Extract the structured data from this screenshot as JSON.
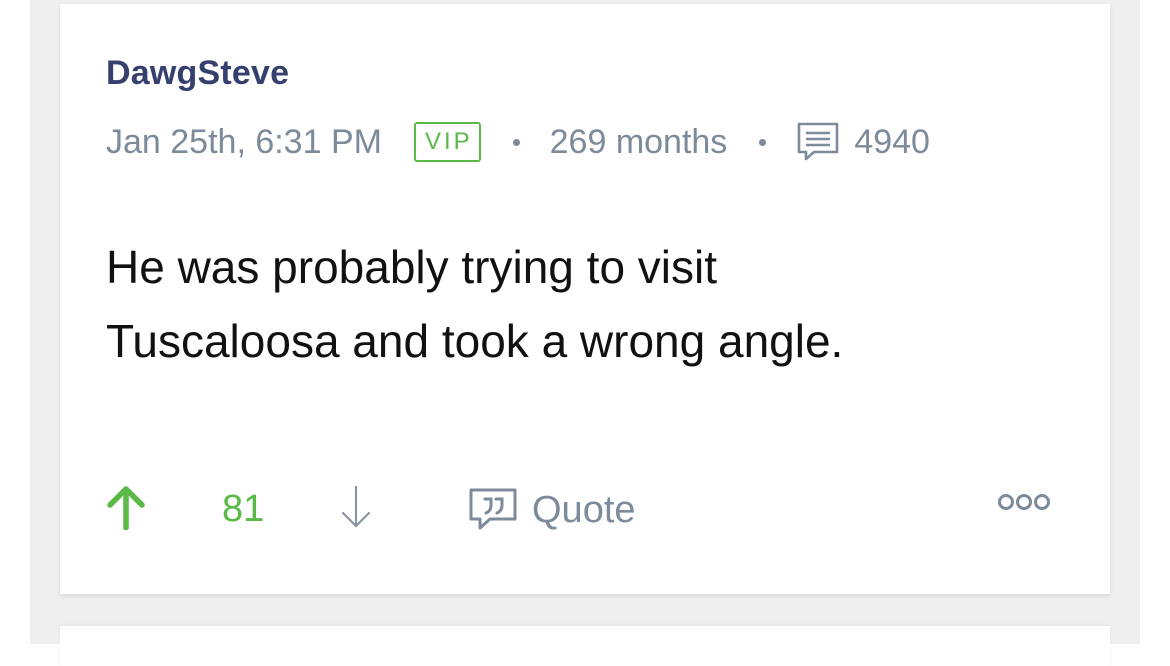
{
  "post": {
    "author": "DawgSteve",
    "timestamp": "Jan 25th, 6:31 PM",
    "badge": "VIP",
    "member_duration": "269 months",
    "post_count": "4940",
    "body_lines": [
      "He was probably trying to visit",
      "Tuscaloosa and took a wrong angle."
    ],
    "votes": "81",
    "quote_label": "Quote"
  },
  "icons": {
    "posts": "comments-icon",
    "upvote": "arrow-up-icon",
    "downvote": "arrow-down-icon",
    "quote": "quote-bubble-icon",
    "more": "more-options-icon"
  },
  "colors": {
    "username": "#36406e",
    "meta": "#7d8a99",
    "vip": "#5ab947",
    "upvote": "#5ab947",
    "body_text": "#111111"
  }
}
